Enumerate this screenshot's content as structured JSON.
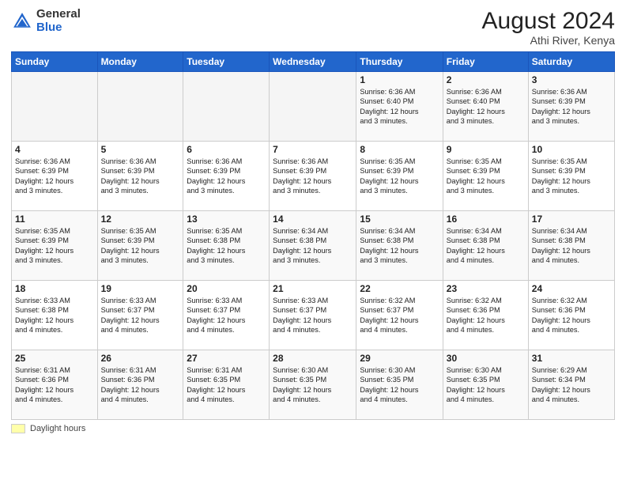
{
  "header": {
    "logo_line1": "General",
    "logo_line2": "Blue",
    "month_year": "August 2024",
    "location": "Athi River, Kenya"
  },
  "weekdays": [
    "Sunday",
    "Monday",
    "Tuesday",
    "Wednesday",
    "Thursday",
    "Friday",
    "Saturday"
  ],
  "footer": {
    "daylight_label": "Daylight hours"
  },
  "weeks": [
    [
      {
        "day": "",
        "detail": ""
      },
      {
        "day": "",
        "detail": ""
      },
      {
        "day": "",
        "detail": ""
      },
      {
        "day": "",
        "detail": ""
      },
      {
        "day": "1",
        "detail": "Sunrise: 6:36 AM\nSunset: 6:40 PM\nDaylight: 12 hours\nand 3 minutes."
      },
      {
        "day": "2",
        "detail": "Sunrise: 6:36 AM\nSunset: 6:40 PM\nDaylight: 12 hours\nand 3 minutes."
      },
      {
        "day": "3",
        "detail": "Sunrise: 6:36 AM\nSunset: 6:39 PM\nDaylight: 12 hours\nand 3 minutes."
      }
    ],
    [
      {
        "day": "4",
        "detail": "Sunrise: 6:36 AM\nSunset: 6:39 PM\nDaylight: 12 hours\nand 3 minutes."
      },
      {
        "day": "5",
        "detail": "Sunrise: 6:36 AM\nSunset: 6:39 PM\nDaylight: 12 hours\nand 3 minutes."
      },
      {
        "day": "6",
        "detail": "Sunrise: 6:36 AM\nSunset: 6:39 PM\nDaylight: 12 hours\nand 3 minutes."
      },
      {
        "day": "7",
        "detail": "Sunrise: 6:36 AM\nSunset: 6:39 PM\nDaylight: 12 hours\nand 3 minutes."
      },
      {
        "day": "8",
        "detail": "Sunrise: 6:35 AM\nSunset: 6:39 PM\nDaylight: 12 hours\nand 3 minutes."
      },
      {
        "day": "9",
        "detail": "Sunrise: 6:35 AM\nSunset: 6:39 PM\nDaylight: 12 hours\nand 3 minutes."
      },
      {
        "day": "10",
        "detail": "Sunrise: 6:35 AM\nSunset: 6:39 PM\nDaylight: 12 hours\nand 3 minutes."
      }
    ],
    [
      {
        "day": "11",
        "detail": "Sunrise: 6:35 AM\nSunset: 6:39 PM\nDaylight: 12 hours\nand 3 minutes."
      },
      {
        "day": "12",
        "detail": "Sunrise: 6:35 AM\nSunset: 6:39 PM\nDaylight: 12 hours\nand 3 minutes."
      },
      {
        "day": "13",
        "detail": "Sunrise: 6:35 AM\nSunset: 6:38 PM\nDaylight: 12 hours\nand 3 minutes."
      },
      {
        "day": "14",
        "detail": "Sunrise: 6:34 AM\nSunset: 6:38 PM\nDaylight: 12 hours\nand 3 minutes."
      },
      {
        "day": "15",
        "detail": "Sunrise: 6:34 AM\nSunset: 6:38 PM\nDaylight: 12 hours\nand 3 minutes."
      },
      {
        "day": "16",
        "detail": "Sunrise: 6:34 AM\nSunset: 6:38 PM\nDaylight: 12 hours\nand 4 minutes."
      },
      {
        "day": "17",
        "detail": "Sunrise: 6:34 AM\nSunset: 6:38 PM\nDaylight: 12 hours\nand 4 minutes."
      }
    ],
    [
      {
        "day": "18",
        "detail": "Sunrise: 6:33 AM\nSunset: 6:38 PM\nDaylight: 12 hours\nand 4 minutes."
      },
      {
        "day": "19",
        "detail": "Sunrise: 6:33 AM\nSunset: 6:37 PM\nDaylight: 12 hours\nand 4 minutes."
      },
      {
        "day": "20",
        "detail": "Sunrise: 6:33 AM\nSunset: 6:37 PM\nDaylight: 12 hours\nand 4 minutes."
      },
      {
        "day": "21",
        "detail": "Sunrise: 6:33 AM\nSunset: 6:37 PM\nDaylight: 12 hours\nand 4 minutes."
      },
      {
        "day": "22",
        "detail": "Sunrise: 6:32 AM\nSunset: 6:37 PM\nDaylight: 12 hours\nand 4 minutes."
      },
      {
        "day": "23",
        "detail": "Sunrise: 6:32 AM\nSunset: 6:36 PM\nDaylight: 12 hours\nand 4 minutes."
      },
      {
        "day": "24",
        "detail": "Sunrise: 6:32 AM\nSunset: 6:36 PM\nDaylight: 12 hours\nand 4 minutes."
      }
    ],
    [
      {
        "day": "25",
        "detail": "Sunrise: 6:31 AM\nSunset: 6:36 PM\nDaylight: 12 hours\nand 4 minutes."
      },
      {
        "day": "26",
        "detail": "Sunrise: 6:31 AM\nSunset: 6:36 PM\nDaylight: 12 hours\nand 4 minutes."
      },
      {
        "day": "27",
        "detail": "Sunrise: 6:31 AM\nSunset: 6:35 PM\nDaylight: 12 hours\nand 4 minutes."
      },
      {
        "day": "28",
        "detail": "Sunrise: 6:30 AM\nSunset: 6:35 PM\nDaylight: 12 hours\nand 4 minutes."
      },
      {
        "day": "29",
        "detail": "Sunrise: 6:30 AM\nSunset: 6:35 PM\nDaylight: 12 hours\nand 4 minutes."
      },
      {
        "day": "30",
        "detail": "Sunrise: 6:30 AM\nSunset: 6:35 PM\nDaylight: 12 hours\nand 4 minutes."
      },
      {
        "day": "31",
        "detail": "Sunrise: 6:29 AM\nSunset: 6:34 PM\nDaylight: 12 hours\nand 4 minutes."
      }
    ]
  ]
}
